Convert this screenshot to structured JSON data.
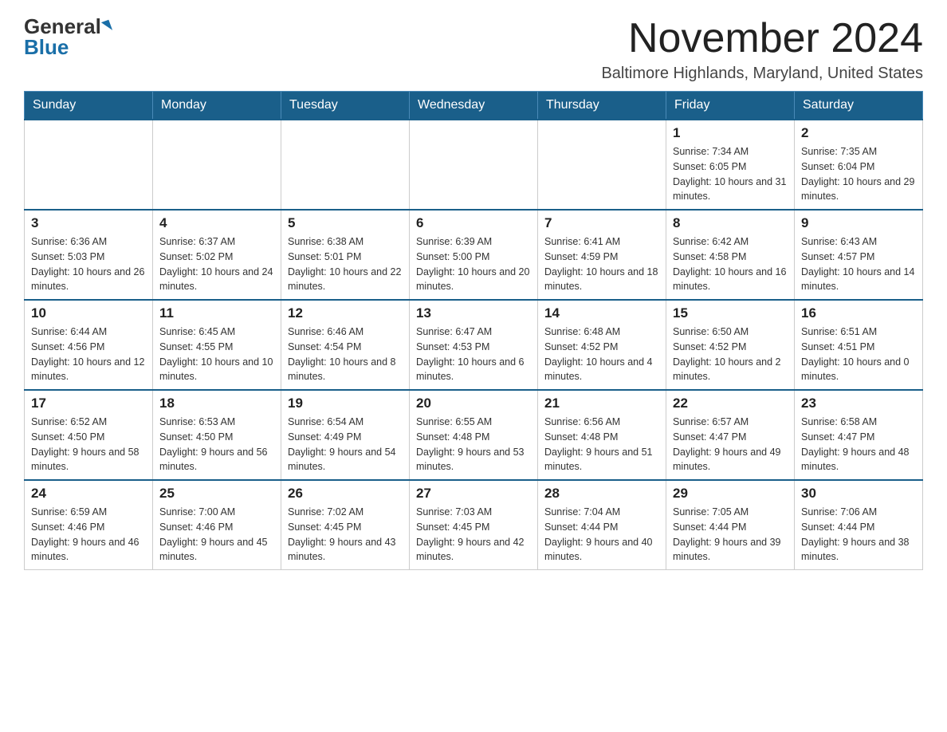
{
  "logo": {
    "general": "General",
    "blue": "Blue"
  },
  "title": "November 2024",
  "subtitle": "Baltimore Highlands, Maryland, United States",
  "days_of_week": [
    "Sunday",
    "Monday",
    "Tuesday",
    "Wednesday",
    "Thursday",
    "Friday",
    "Saturday"
  ],
  "weeks": [
    [
      {
        "day": "",
        "info": ""
      },
      {
        "day": "",
        "info": ""
      },
      {
        "day": "",
        "info": ""
      },
      {
        "day": "",
        "info": ""
      },
      {
        "day": "",
        "info": ""
      },
      {
        "day": "1",
        "info": "Sunrise: 7:34 AM\nSunset: 6:05 PM\nDaylight: 10 hours and 31 minutes."
      },
      {
        "day": "2",
        "info": "Sunrise: 7:35 AM\nSunset: 6:04 PM\nDaylight: 10 hours and 29 minutes."
      }
    ],
    [
      {
        "day": "3",
        "info": "Sunrise: 6:36 AM\nSunset: 5:03 PM\nDaylight: 10 hours and 26 minutes."
      },
      {
        "day": "4",
        "info": "Sunrise: 6:37 AM\nSunset: 5:02 PM\nDaylight: 10 hours and 24 minutes."
      },
      {
        "day": "5",
        "info": "Sunrise: 6:38 AM\nSunset: 5:01 PM\nDaylight: 10 hours and 22 minutes."
      },
      {
        "day": "6",
        "info": "Sunrise: 6:39 AM\nSunset: 5:00 PM\nDaylight: 10 hours and 20 minutes."
      },
      {
        "day": "7",
        "info": "Sunrise: 6:41 AM\nSunset: 4:59 PM\nDaylight: 10 hours and 18 minutes."
      },
      {
        "day": "8",
        "info": "Sunrise: 6:42 AM\nSunset: 4:58 PM\nDaylight: 10 hours and 16 minutes."
      },
      {
        "day": "9",
        "info": "Sunrise: 6:43 AM\nSunset: 4:57 PM\nDaylight: 10 hours and 14 minutes."
      }
    ],
    [
      {
        "day": "10",
        "info": "Sunrise: 6:44 AM\nSunset: 4:56 PM\nDaylight: 10 hours and 12 minutes."
      },
      {
        "day": "11",
        "info": "Sunrise: 6:45 AM\nSunset: 4:55 PM\nDaylight: 10 hours and 10 minutes."
      },
      {
        "day": "12",
        "info": "Sunrise: 6:46 AM\nSunset: 4:54 PM\nDaylight: 10 hours and 8 minutes."
      },
      {
        "day": "13",
        "info": "Sunrise: 6:47 AM\nSunset: 4:53 PM\nDaylight: 10 hours and 6 minutes."
      },
      {
        "day": "14",
        "info": "Sunrise: 6:48 AM\nSunset: 4:52 PM\nDaylight: 10 hours and 4 minutes."
      },
      {
        "day": "15",
        "info": "Sunrise: 6:50 AM\nSunset: 4:52 PM\nDaylight: 10 hours and 2 minutes."
      },
      {
        "day": "16",
        "info": "Sunrise: 6:51 AM\nSunset: 4:51 PM\nDaylight: 10 hours and 0 minutes."
      }
    ],
    [
      {
        "day": "17",
        "info": "Sunrise: 6:52 AM\nSunset: 4:50 PM\nDaylight: 9 hours and 58 minutes."
      },
      {
        "day": "18",
        "info": "Sunrise: 6:53 AM\nSunset: 4:50 PM\nDaylight: 9 hours and 56 minutes."
      },
      {
        "day": "19",
        "info": "Sunrise: 6:54 AM\nSunset: 4:49 PM\nDaylight: 9 hours and 54 minutes."
      },
      {
        "day": "20",
        "info": "Sunrise: 6:55 AM\nSunset: 4:48 PM\nDaylight: 9 hours and 53 minutes."
      },
      {
        "day": "21",
        "info": "Sunrise: 6:56 AM\nSunset: 4:48 PM\nDaylight: 9 hours and 51 minutes."
      },
      {
        "day": "22",
        "info": "Sunrise: 6:57 AM\nSunset: 4:47 PM\nDaylight: 9 hours and 49 minutes."
      },
      {
        "day": "23",
        "info": "Sunrise: 6:58 AM\nSunset: 4:47 PM\nDaylight: 9 hours and 48 minutes."
      }
    ],
    [
      {
        "day": "24",
        "info": "Sunrise: 6:59 AM\nSunset: 4:46 PM\nDaylight: 9 hours and 46 minutes."
      },
      {
        "day": "25",
        "info": "Sunrise: 7:00 AM\nSunset: 4:46 PM\nDaylight: 9 hours and 45 minutes."
      },
      {
        "day": "26",
        "info": "Sunrise: 7:02 AM\nSunset: 4:45 PM\nDaylight: 9 hours and 43 minutes."
      },
      {
        "day": "27",
        "info": "Sunrise: 7:03 AM\nSunset: 4:45 PM\nDaylight: 9 hours and 42 minutes."
      },
      {
        "day": "28",
        "info": "Sunrise: 7:04 AM\nSunset: 4:44 PM\nDaylight: 9 hours and 40 minutes."
      },
      {
        "day": "29",
        "info": "Sunrise: 7:05 AM\nSunset: 4:44 PM\nDaylight: 9 hours and 39 minutes."
      },
      {
        "day": "30",
        "info": "Sunrise: 7:06 AM\nSunset: 4:44 PM\nDaylight: 9 hours and 38 minutes."
      }
    ]
  ]
}
